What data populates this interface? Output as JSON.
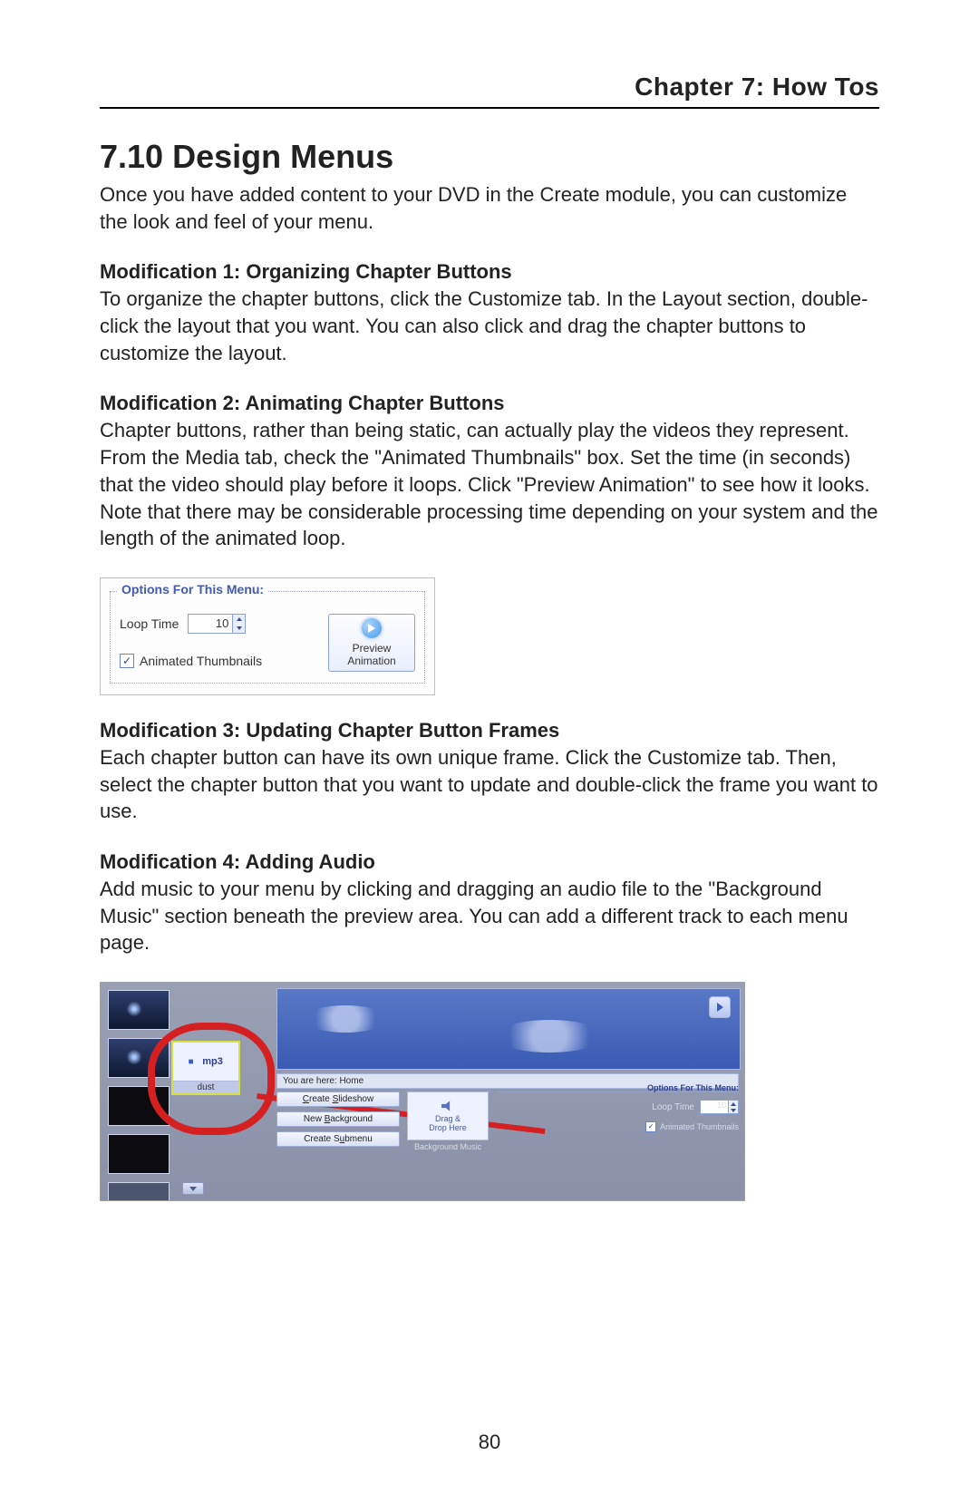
{
  "header": {
    "chapter": "Chapter 7:  How Tos"
  },
  "section": {
    "number_title": "7.10  Design Menus",
    "intro": "Once you have added content to your DVD in the Create module, you can customize the look and feel of your menu."
  },
  "mod1": {
    "heading": "Modification 1: Organizing Chapter Buttons",
    "body": "To organize the chapter buttons, click the Customize tab. In the Layout section, double-click the layout that you want. You can also click and drag the chapter buttons to customize the layout."
  },
  "mod2": {
    "heading": "Modification 2: Animating Chapter Buttons",
    "body": "Chapter buttons, rather than being static, can actually play the videos they represent. From the Media tab, check the \"Animated Thumbnails\" box. Set the time (in seconds) that the video should play before it loops. Click \"Preview Animation\" to see how it looks. Note that there may be considerable processing time depending on your system and the length of the animated loop."
  },
  "fig1": {
    "legend": "Options For This Menu:",
    "loop_label": "Loop Time",
    "loop_value": "10",
    "checkbox_label": "Animated Thumbnails",
    "checkbox_checked": "✓",
    "preview_label_1": "Preview",
    "preview_label_2": "Animation"
  },
  "mod3": {
    "heading": "Modification 3: Updating Chapter Button Frames",
    "body": "Each chapter button can have its own unique frame. Click the Customize tab. Then, select the chapter button that you want to update and double-click the frame you want to use."
  },
  "mod4": {
    "heading": "Modification 4: Adding Audio",
    "body": "Add music to your menu by clicking and dragging an audio file to the \"Background Music\" section beneath the preview area. You can add a different track to each menu page."
  },
  "fig2": {
    "mp3_label": "mp3",
    "mp3_name": "dust",
    "breadcrumb": "You are here: Home",
    "btn_slideshow": "Create Slideshow",
    "btn_newbg": "New Background",
    "btn_submenu": "Create Submenu",
    "drop_line1": "Drag &",
    "drop_line2": "Drop Here",
    "drop_caption": "Background Music",
    "opts_title": "Options For This Menu:",
    "loop_label": "Loop Time",
    "loop_value": "10",
    "chk_label": "Animated Thumbnails",
    "chk_checked": "✓"
  },
  "page_number": "80"
}
